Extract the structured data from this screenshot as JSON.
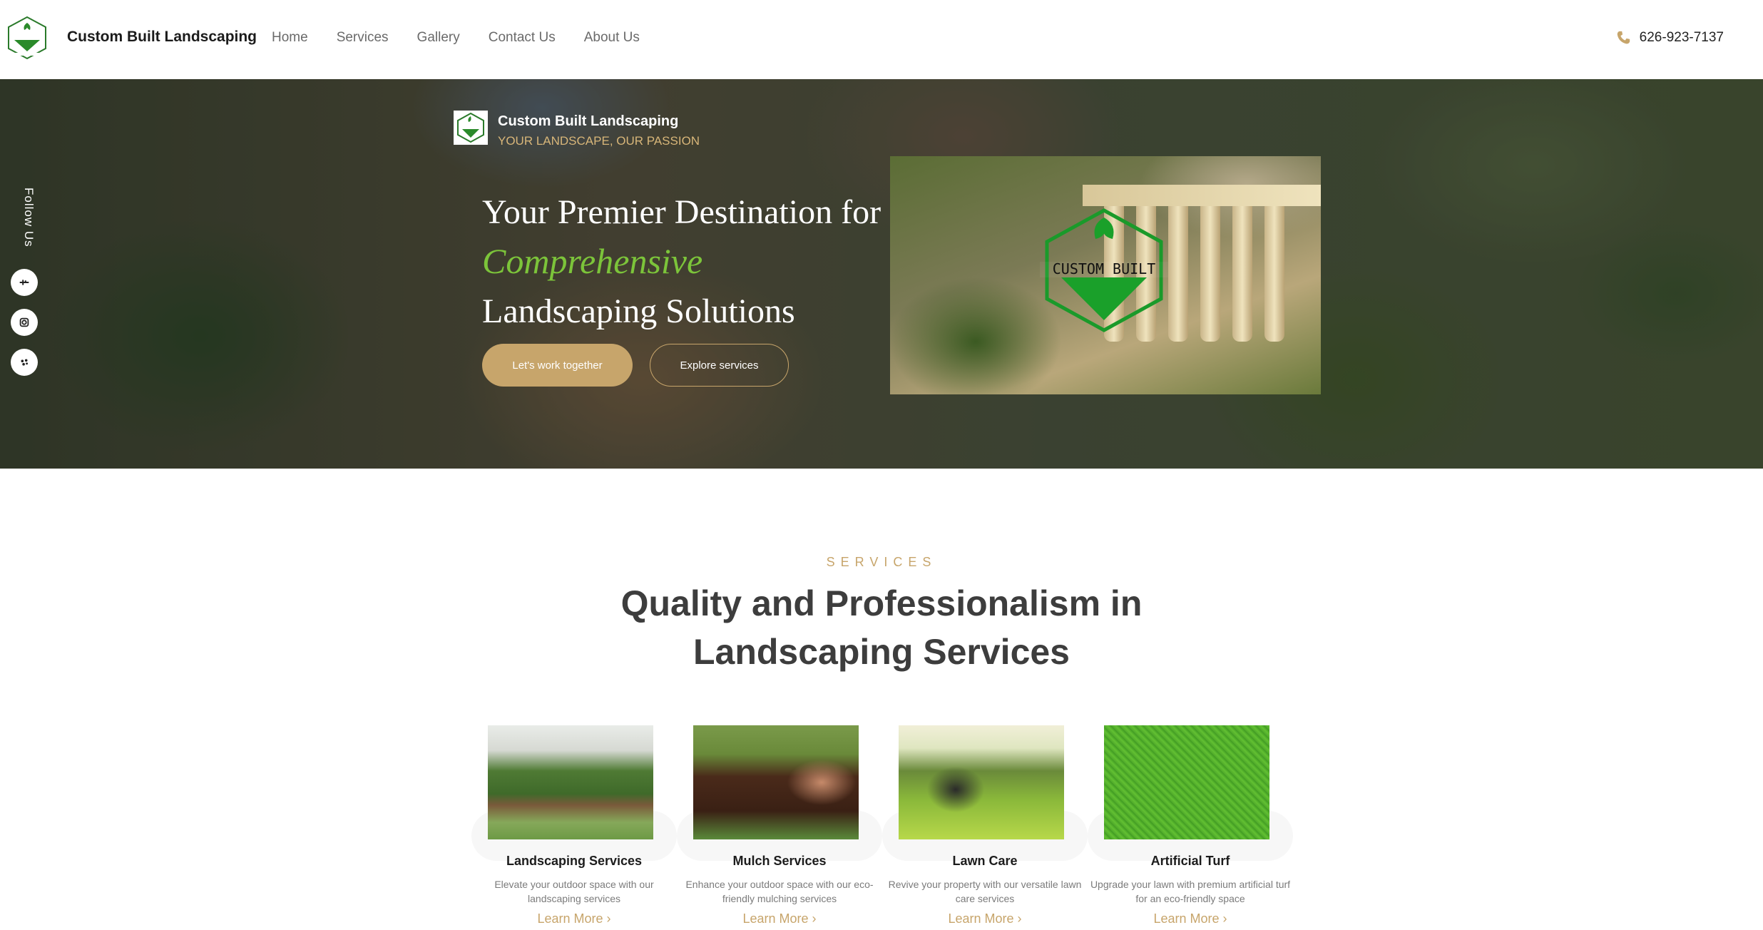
{
  "header": {
    "brand": "Custom Built Landscaping",
    "nav": [
      "Home",
      "Services",
      "Gallery",
      "Contact Us",
      "About Us"
    ],
    "phone": "626-923-7137"
  },
  "hero": {
    "follow_label": "Follow Us",
    "mini_title": "Custom Built Landscaping",
    "mini_tagline": "YOUR LANDSCAPE, OUR PASSION",
    "headline_part1": "Your Premier Destination for ",
    "headline_accent": "Comprehensive",
    "headline_part2": " Landscaping Solutions",
    "primary_button": "Let's work together",
    "secondary_button": "Explore services",
    "photo_logo_text": "CUSTOM BUILT"
  },
  "services": {
    "eyebrow": "SERVICES",
    "title": "Quality and Professionalism in Landscaping Services",
    "cards": [
      {
        "title": "Landscaping Services",
        "desc": "Elevate your outdoor space with our landscaping services",
        "more": "Learn More"
      },
      {
        "title": "Mulch Services",
        "desc": "Enhance your outdoor space with our eco-friendly mulching services",
        "more": "Learn More"
      },
      {
        "title": "Lawn Care",
        "desc": "Revive your property with our versatile lawn care services",
        "more": "Learn More"
      },
      {
        "title": "Artificial Turf",
        "desc": "Upgrade your lawn with premium artificial turf for an eco-friendly space",
        "more": "Learn More"
      }
    ]
  },
  "icons": {
    "phone": "phone-icon",
    "social": [
      "facebook-icon",
      "instagram-icon",
      "yelp-icon"
    ],
    "chevron": "chevron-right-icon"
  },
  "colors": {
    "accent_gold": "#c7a56b",
    "accent_green": "#7cc43a",
    "heading_dark": "#3d3d3d"
  }
}
